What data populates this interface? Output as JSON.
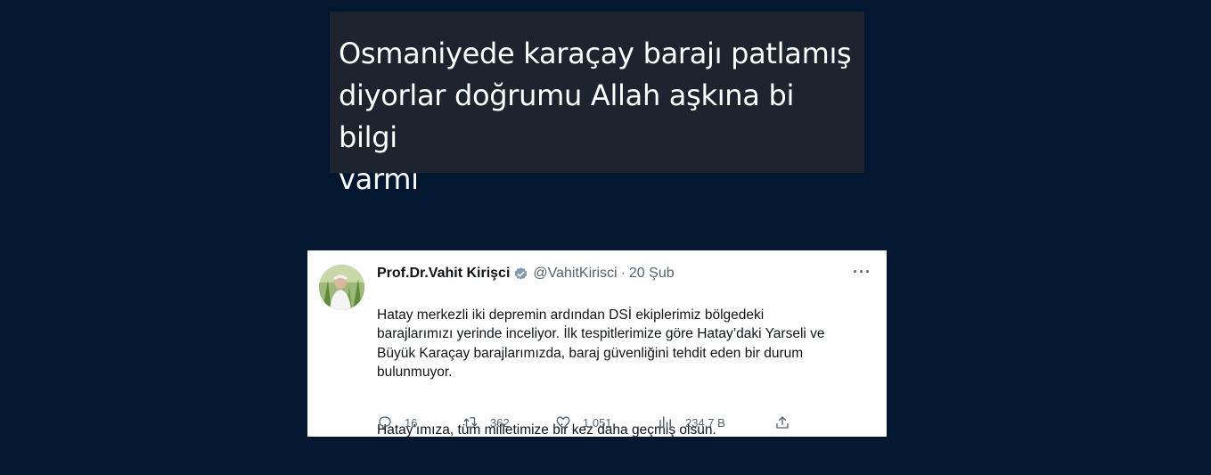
{
  "quote": {
    "text": "Osmaniyede karaçay barajı patlamış\ndiyorlar doğrumu Allah aşkına bi bilgi\nvarmı"
  },
  "tweet": {
    "author_name": "Prof.Dr.Vahit Kirişci",
    "handle": "@VahitKirisci",
    "separator": "·",
    "date": "20 Şub",
    "body_p1": "Hatay merkezli iki depremin ardından DSİ ekiplerimiz bölgedeki\nbarajlarımızı yerinde inceliyor. İlk tespitlerimize göre Hatay’daki Yarseli ve\nBüyük Karaçay barajlarımızda, baraj güvenliğini tehdit eden bir durum\nbulunmuyor.",
    "body_p2": "Hatay’ımıza, tüm milletimize bir kez daha geçmiş olsun.",
    "more_label": "···",
    "actions": {
      "replies": "16",
      "retweets": "362",
      "likes": "1.051",
      "views": "234,7 B"
    },
    "icons": {
      "reply": "reply-icon",
      "retweet": "retweet-icon",
      "like": "heart-icon",
      "views": "views-icon",
      "share": "share-icon",
      "verified": "verified-badge-icon"
    },
    "colors": {
      "verified": "#829aab",
      "muted": "#536471",
      "text": "#0f1419"
    }
  },
  "colors": {
    "page_background": "#031731",
    "quote_background": "#1d2430"
  }
}
